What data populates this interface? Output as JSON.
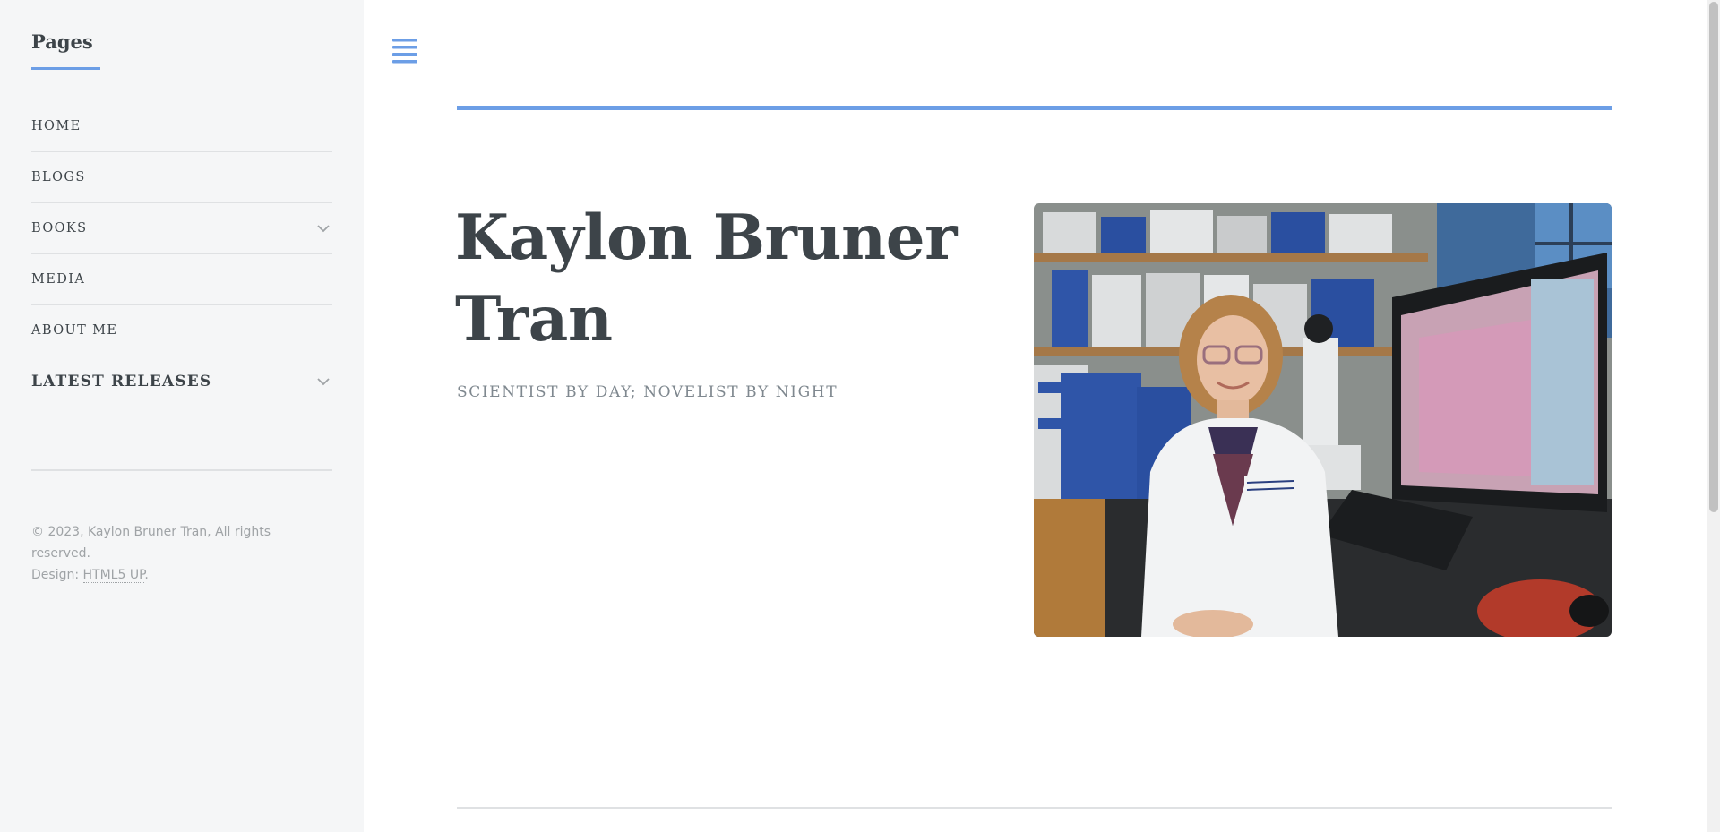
{
  "sidebar": {
    "heading": "Pages",
    "items": [
      {
        "label": "HOME",
        "has_submenu": false
      },
      {
        "label": "BLOGS",
        "has_submenu": false
      },
      {
        "label": "BOOKS",
        "has_submenu": true
      },
      {
        "label": "MEDIA",
        "has_submenu": false
      },
      {
        "label": "ABOUT ME",
        "has_submenu": false
      },
      {
        "label": "LATEST RELEASES",
        "has_submenu": true
      }
    ],
    "footer_copyright": "© 2023, Kaylon Bruner Tran, All rights reserved.",
    "footer_design_prefix": "Design: ",
    "footer_design_link": "HTML5 UP",
    "footer_design_suffix": "."
  },
  "header": {
    "menu_toggle_icon": "hamburger-menu-icon"
  },
  "hero": {
    "title": "Kaylon Bruner Tran",
    "subtitle": "SCIENTIST BY DAY; NOVELIST BY NIGHT",
    "image_description_icon": "author-photo"
  },
  "colors": {
    "accent": "#6c9ee6",
    "text": "#3d4449",
    "muted": "#7f888f",
    "sidebar_bg": "#f5f6f7",
    "border": "#dfe1e3"
  }
}
